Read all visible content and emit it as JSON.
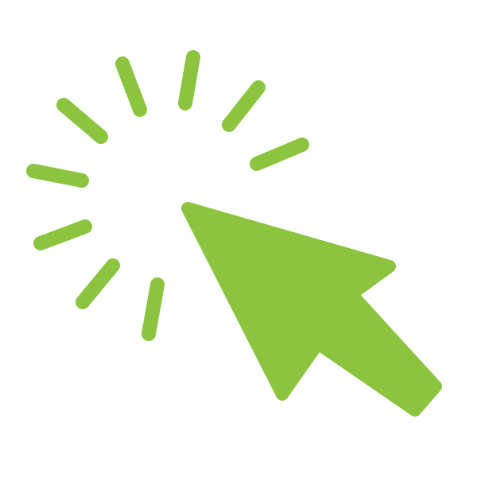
{
  "icon": {
    "name": "click-cursor-icon",
    "color": "#8cc43f",
    "background": "#ffffff"
  }
}
